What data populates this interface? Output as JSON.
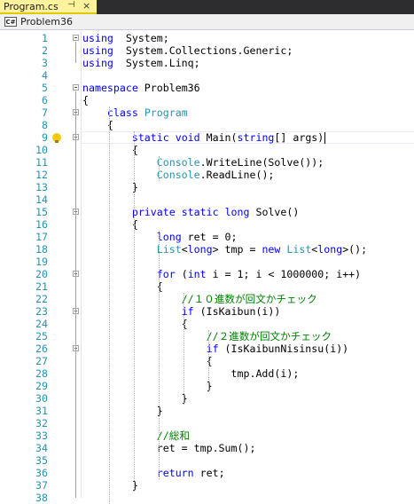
{
  "tab": {
    "title": "Program.cs",
    "pin_glyph": "⊣",
    "close_glyph": "×"
  },
  "navbar": {
    "icon_text": "C#",
    "project": "Problem36"
  },
  "editor": {
    "current_line": 9,
    "lines": [
      {
        "n": "1",
        "segs": [
          [
            "kw",
            "using"
          ],
          [
            "",
            "  System;"
          ]
        ]
      },
      {
        "n": "2",
        "segs": [
          [
            "kw",
            "using"
          ],
          [
            "",
            "  System.Collections.Generic;"
          ]
        ]
      },
      {
        "n": "3",
        "segs": [
          [
            "kw",
            "using"
          ],
          [
            "",
            "  System.Linq;"
          ]
        ]
      },
      {
        "n": "4",
        "segs": []
      },
      {
        "n": "5",
        "segs": [
          [
            "kw",
            "namespace"
          ],
          [
            "",
            " Problem36"
          ]
        ]
      },
      {
        "n": "6",
        "segs": [
          [
            "",
            "{"
          ]
        ]
      },
      {
        "n": "7",
        "segs": [
          [
            "",
            "    "
          ],
          [
            "kw",
            "class"
          ],
          [
            "",
            " "
          ],
          [
            "ty",
            "Program"
          ]
        ]
      },
      {
        "n": "8",
        "segs": [
          [
            "",
            "    {"
          ]
        ]
      },
      {
        "n": "9",
        "segs": [
          [
            "",
            "        "
          ],
          [
            "kw",
            "static"
          ],
          [
            "",
            " "
          ],
          [
            "kw",
            "void"
          ],
          [
            "",
            " Main("
          ],
          [
            "kw",
            "string"
          ],
          [
            "",
            "[] args)"
          ]
        ]
      },
      {
        "n": "10",
        "segs": [
          [
            "",
            "        {"
          ]
        ]
      },
      {
        "n": "11",
        "segs": [
          [
            "",
            "            "
          ],
          [
            "ty",
            "Console"
          ],
          [
            "",
            ".WriteLine(Solve());"
          ]
        ]
      },
      {
        "n": "12",
        "segs": [
          [
            "",
            "            "
          ],
          [
            "ty",
            "Console"
          ],
          [
            "",
            ".ReadLine();"
          ]
        ]
      },
      {
        "n": "13",
        "segs": [
          [
            "",
            "        }"
          ]
        ]
      },
      {
        "n": "14",
        "segs": []
      },
      {
        "n": "15",
        "segs": [
          [
            "",
            "        "
          ],
          [
            "kw",
            "private"
          ],
          [
            "",
            " "
          ],
          [
            "kw",
            "static"
          ],
          [
            "",
            " "
          ],
          [
            "kw",
            "long"
          ],
          [
            "",
            " Solve()"
          ]
        ]
      },
      {
        "n": "16",
        "segs": [
          [
            "",
            "        {"
          ]
        ]
      },
      {
        "n": "17",
        "segs": [
          [
            "",
            "            "
          ],
          [
            "kw",
            "long"
          ],
          [
            "",
            " ret = 0;"
          ]
        ]
      },
      {
        "n": "18",
        "segs": [
          [
            "",
            "            "
          ],
          [
            "ty",
            "List"
          ],
          [
            "",
            "<"
          ],
          [
            "kw",
            "long"
          ],
          [
            "",
            "> tmp = "
          ],
          [
            "kw",
            "new"
          ],
          [
            "",
            " "
          ],
          [
            "ty",
            "List"
          ],
          [
            "",
            "<"
          ],
          [
            "kw",
            "long"
          ],
          [
            "",
            ">();"
          ]
        ]
      },
      {
        "n": "19",
        "segs": []
      },
      {
        "n": "20",
        "segs": [
          [
            "",
            "            "
          ],
          [
            "kw",
            "for"
          ],
          [
            "",
            " ("
          ],
          [
            "kw",
            "int"
          ],
          [
            "",
            " i = 1; i < 1000000; i++)"
          ]
        ]
      },
      {
        "n": "21",
        "segs": [
          [
            "",
            "            {"
          ]
        ]
      },
      {
        "n": "22",
        "segs": [
          [
            "",
            "                "
          ],
          [
            "cm",
            "//１０進数が回文かチェック"
          ]
        ]
      },
      {
        "n": "23",
        "segs": [
          [
            "",
            "                "
          ],
          [
            "kw",
            "if"
          ],
          [
            "",
            " (IsKaibun(i))"
          ]
        ]
      },
      {
        "n": "24",
        "segs": [
          [
            "",
            "                {"
          ]
        ]
      },
      {
        "n": "25",
        "segs": [
          [
            "",
            "                    "
          ],
          [
            "cm",
            "//２進数が回文かチェック"
          ]
        ]
      },
      {
        "n": "26",
        "segs": [
          [
            "",
            "                    "
          ],
          [
            "kw",
            "if"
          ],
          [
            "",
            " (IsKaibunNisinsu(i))"
          ]
        ]
      },
      {
        "n": "27",
        "segs": [
          [
            "",
            "                    {"
          ]
        ]
      },
      {
        "n": "28",
        "segs": [
          [
            "",
            "                        tmp.Add(i);"
          ]
        ]
      },
      {
        "n": "29",
        "segs": [
          [
            "",
            "                    }"
          ]
        ]
      },
      {
        "n": "30",
        "segs": [
          [
            "",
            "                }"
          ]
        ]
      },
      {
        "n": "31",
        "segs": [
          [
            "",
            "            }"
          ]
        ]
      },
      {
        "n": "32",
        "segs": []
      },
      {
        "n": "33",
        "segs": [
          [
            "",
            "            "
          ],
          [
            "cm",
            "//総和"
          ]
        ]
      },
      {
        "n": "34",
        "segs": [
          [
            "",
            "            ret = tmp.Sum();"
          ]
        ]
      },
      {
        "n": "35",
        "segs": []
      },
      {
        "n": "36",
        "segs": [
          [
            "",
            "            "
          ],
          [
            "kw",
            "return"
          ],
          [
            "",
            " ret;"
          ]
        ]
      },
      {
        "n": "37",
        "segs": [
          [
            "",
            "        }"
          ]
        ]
      },
      {
        "n": "38",
        "segs": []
      }
    ]
  }
}
